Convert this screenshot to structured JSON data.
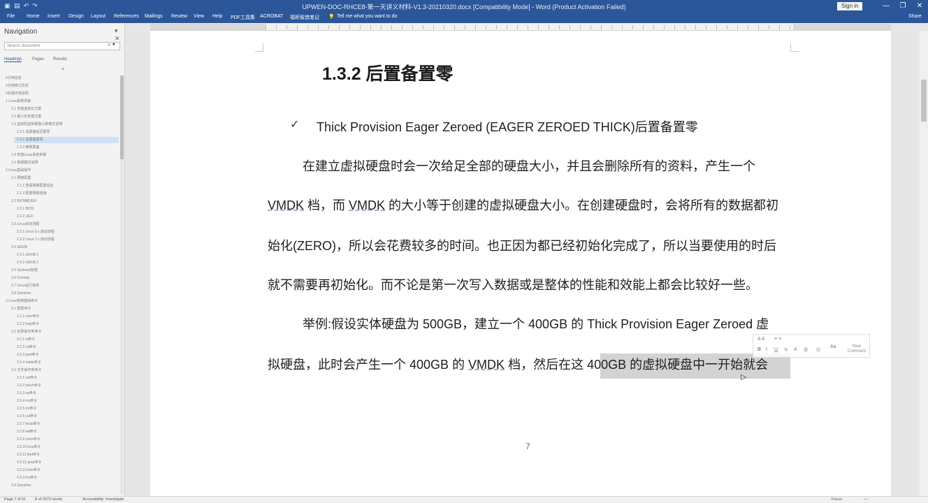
{
  "window": {
    "title": "UPWEN-DOC-RHCE8-第一天讲义材料-V1.3-20210320.docx [Compatibility Mode] - Word (Product Activation Failed)",
    "sign_in": "Sign in",
    "minimize": "—",
    "restore": "❐",
    "close": "✕"
  },
  "ribbon": {
    "tabs": [
      "File",
      "Home",
      "Insert",
      "Design",
      "Layout",
      "References",
      "Mailings",
      "Review",
      "View",
      "Help",
      "PDF工具集",
      "ACROBAT",
      "福昕智造笔记",
      "Tell me what you want to do"
    ],
    "share": "Share"
  },
  "navigation": {
    "title": "Navigation",
    "search_placeholder": "Search document",
    "tabs": [
      "Headings",
      "Pages",
      "Results"
    ],
    "items": [
      {
        "text": "#文档信息",
        "indent": 0
      },
      {
        "text": "#文档修订历史",
        "indent": 0
      },
      {
        "text": "#实验环境说明",
        "indent": 0
      },
      {
        "text": "1 Linux系统安装",
        "indent": 0
      },
      {
        "text": "1.1 安装虚拟化方案",
        "indent": 1
      },
      {
        "text": "1.2 最小化安装方案",
        "indent": 1
      },
      {
        "text": "1.3 虚拟机虚拟硬盘三种格式说明",
        "indent": 1
      },
      {
        "text": "1.3.1 后置备延迟置零",
        "indent": 2
      },
      {
        "text": "1.3.2 后置备置零",
        "indent": 2,
        "selected": true
      },
      {
        "text": "1.3.3 精简置备",
        "indent": 2
      },
      {
        "text": "1.4 安装Linux系统步骤",
        "indent": 1
      },
      {
        "text": "1.5 救援模式说明",
        "indent": 1
      },
      {
        "text": "2 Linux基础操作",
        "indent": 0
      },
      {
        "text": "2.1 网络配置",
        "indent": 1
      },
      {
        "text": "2.1.1 查看网络配置信息",
        "indent": 2
      },
      {
        "text": "2.1.2 配置网络连接",
        "indent": 2
      },
      {
        "text": "2.2 BIOS和UEFI",
        "indent": 1
      },
      {
        "text": "2.2.1 BIOS",
        "indent": 2
      },
      {
        "text": "2.2.2 UEFI",
        "indent": 2
      },
      {
        "text": "2.3 Linux启动流程",
        "indent": 1
      },
      {
        "text": "2.3.1 Linux 6.x 启动流程",
        "indent": 2
      },
      {
        "text": "2.3.2 Linux 7.x 启动流程",
        "indent": 2
      },
      {
        "text": "2.4 GRUB",
        "indent": 1
      },
      {
        "text": "2.4.1 GRUB 1",
        "indent": 2
      },
      {
        "text": "2.4.2 GRUB 2",
        "indent": 2
      },
      {
        "text": "2.5 Systemd管理",
        "indent": 1
      },
      {
        "text": "2.6 Crontab",
        "indent": 1
      },
      {
        "text": "2.7 Linux运行级别",
        "indent": 1
      },
      {
        "text": "2.8 Question",
        "indent": 1
      },
      {
        "text": "3 Linux常用基础命令",
        "indent": 0
      },
      {
        "text": "3.1 帮助命令",
        "indent": 1
      },
      {
        "text": "3.1.1 man命令",
        "indent": 2
      },
      {
        "text": "3.1.2 help命令",
        "indent": 2
      },
      {
        "text": "3.2 目录操作类命令",
        "indent": 1
      },
      {
        "text": "3.2.1 ls命令",
        "indent": 2
      },
      {
        "text": "3.2.2 cd命令",
        "indent": 2
      },
      {
        "text": "3.2.3 pwd命令",
        "indent": 2
      },
      {
        "text": "3.2.4 mkdir命令",
        "indent": 2
      },
      {
        "text": "3.3 文件操作类命令",
        "indent": 1
      },
      {
        "text": "3.3.1 cat命令",
        "indent": 2
      },
      {
        "text": "3.3.2 touch命令",
        "indent": 2
      },
      {
        "text": "3.3.3 cp命令",
        "indent": 2
      },
      {
        "text": "3.3.4 mv命令",
        "indent": 2
      },
      {
        "text": "3.3.5 rm命令",
        "indent": 2
      },
      {
        "text": "3.3.6 cat命令",
        "indent": 2
      },
      {
        "text": "3.3.7 head命令",
        "indent": 2
      },
      {
        "text": "3.3.8 tail命令",
        "indent": 2
      },
      {
        "text": "3.3.9 more命令",
        "indent": 2
      },
      {
        "text": "3.3.10 less命令",
        "indent": 2
      },
      {
        "text": "3.3.11 find命令",
        "indent": 2
      },
      {
        "text": "3.3.12 grep命令",
        "indent": 2
      },
      {
        "text": "3.3.13 tree命令",
        "indent": 2
      },
      {
        "text": "3.3.14 ln命令",
        "indent": 2
      },
      {
        "text": "3.4 Question",
        "indent": 1
      }
    ]
  },
  "document": {
    "heading": "1.3.2 后置备置零",
    "bullet_mark": "✓",
    "bullet": "Thick Provision Eager Zeroed (EAGER ZEROED THICK)后置备置零",
    "p1": {
      "l1": "在建立虚拟硬盘时会一次给足全部的硬盘大小，并且会删除所有的资料，产生一个",
      "l2a": "VMDK",
      "l2b": " 档，而 ",
      "l2c": "VMDK",
      "l2d": " 的大小等于创建的虚拟硬盘大小。在创建硬盘时，会将所有的数据都初",
      "l3": "始化(ZERO)，所以会花费较多的时间。也正因为都已经初始化完成了，所以当要使用的时后",
      "l4": "就不需要再初始化。而不论是第一次写入数据或是整体的性能和效能上都会比较好一些。"
    },
    "p2": {
      "l1": "举例:假设实体硬盘为 500GB，建立一个 400GB 的 Thick Provision Eager Zeroed  虚",
      "l2a": "拟硬盘，此时会产生一个 400GB 的 ",
      "l2b": "VMDK",
      "l2c": " 档，然后在这 400GB 的虚拟硬盘中一开始就会"
    },
    "page_number": "7"
  },
  "mini_toolbar": {
    "new_comment": "New Comment"
  },
  "status": {
    "page": "Page 7 of 51",
    "words": "8 of 2973 words",
    "accessibility": "Accessibility: Investigate",
    "focus": "Focus",
    "zoom": "—"
  }
}
